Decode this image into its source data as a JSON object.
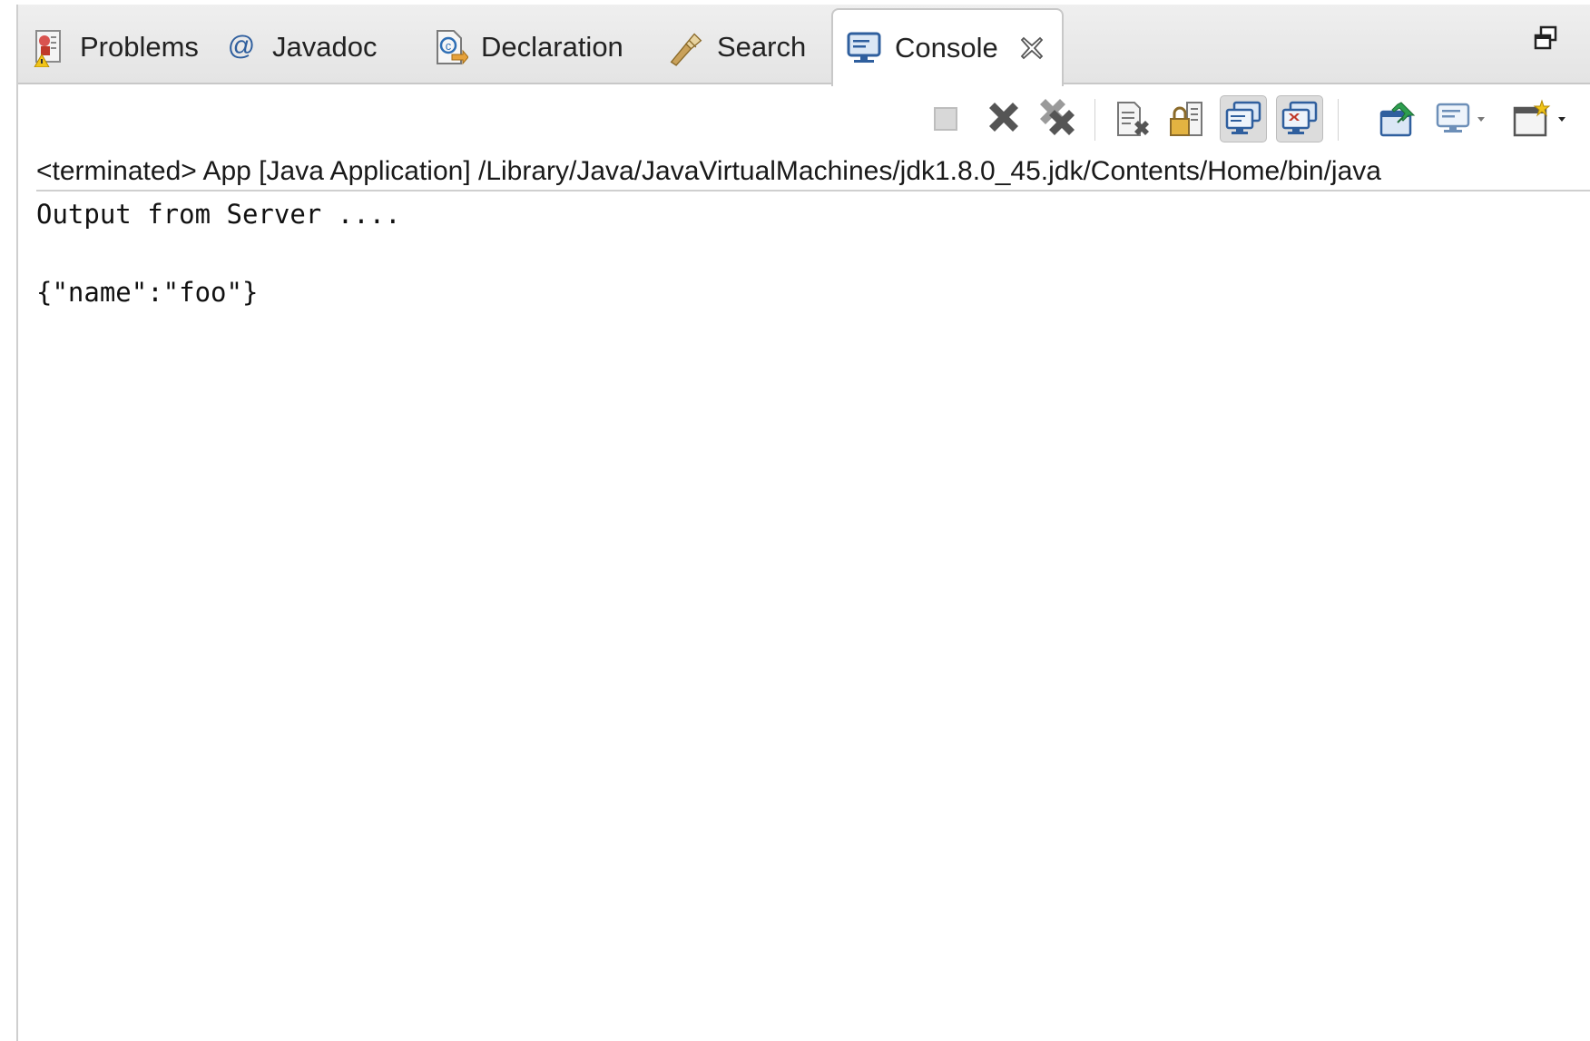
{
  "tabs": [
    {
      "label": "Problems",
      "icon": "problems-icon"
    },
    {
      "label": "Javadoc",
      "icon": "at-icon"
    },
    {
      "label": "Declaration",
      "icon": "declaration-icon"
    },
    {
      "label": "Search",
      "icon": "search-flashlight-icon"
    },
    {
      "label": "Console",
      "icon": "console-monitor-icon",
      "active": true
    }
  ],
  "toolbar": {
    "buttons": [
      "terminate-icon",
      "remove-launch-icon",
      "remove-all-terminated-icon",
      "clear-console-icon",
      "scroll-lock-icon",
      "show-on-stdout-icon",
      "show-on-stderr-icon",
      "pin-console-icon",
      "display-selected-console-icon",
      "open-console-icon"
    ]
  },
  "console": {
    "launch_info": "<terminated> App [Java Application] /Library/Java/JavaVirtualMachines/jdk1.8.0_45.jdk/Contents/Home/bin/java",
    "lines": [
      "Output from Server ....",
      "",
      "{\"name\":\"foo\"}"
    ]
  },
  "colors": {
    "tab_bar": "#e6e6e6",
    "border": "#c8c8c8",
    "icon_blue": "#2f5f9e",
    "icon_red": "#c0392b"
  }
}
